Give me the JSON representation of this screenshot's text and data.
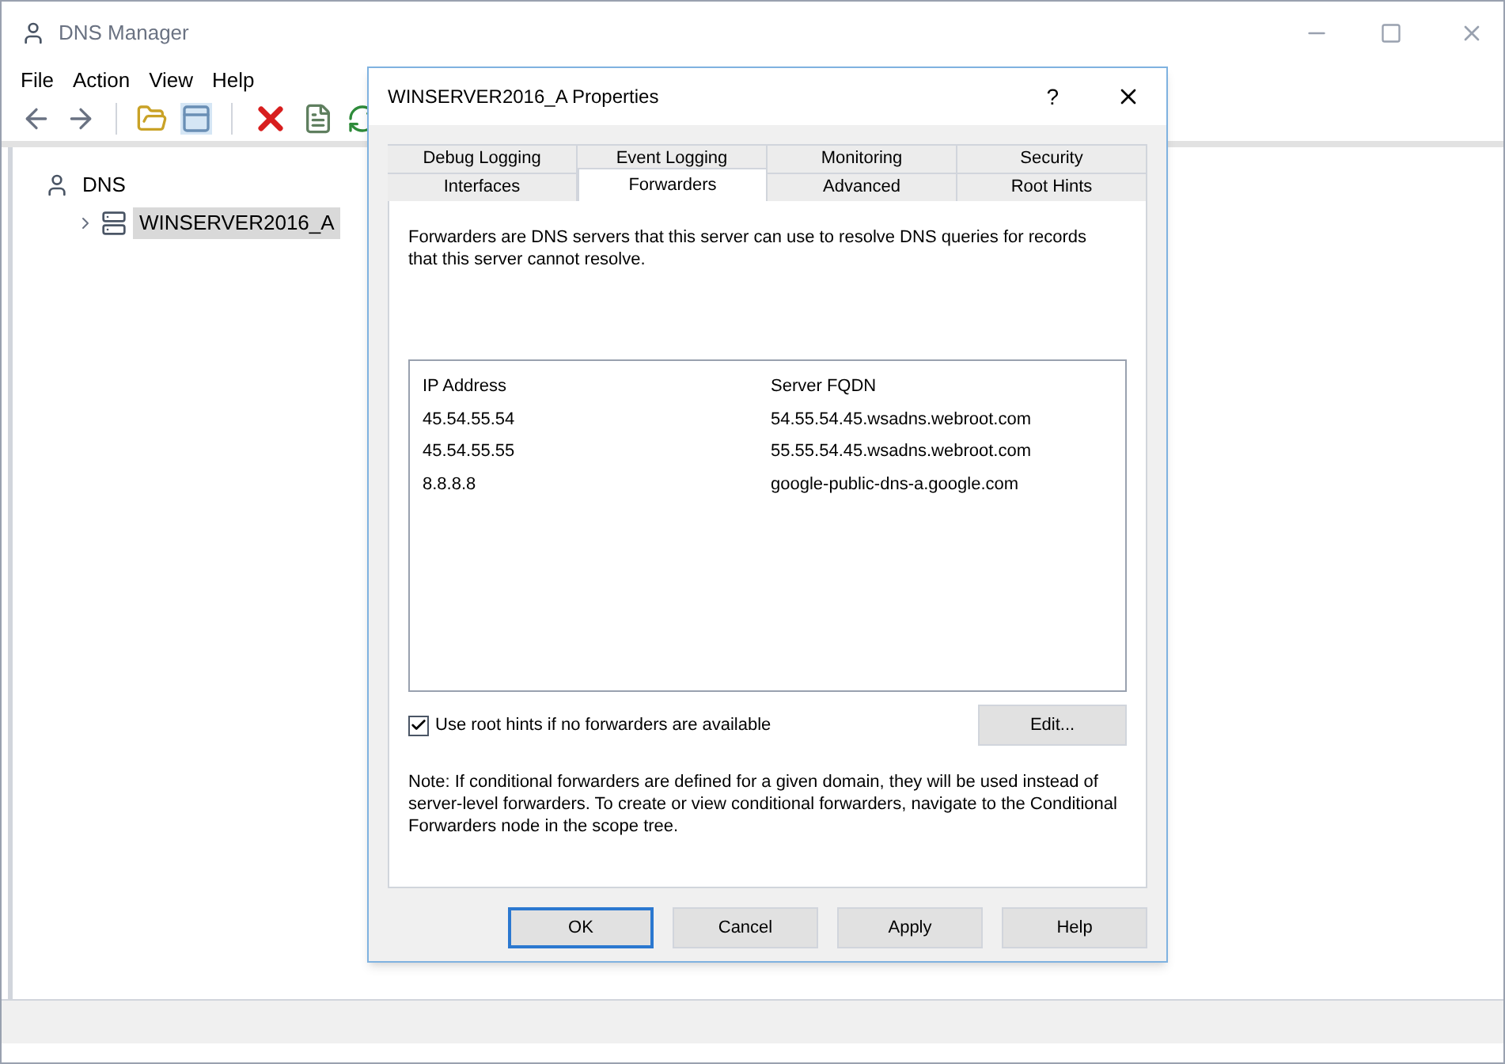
{
  "window": {
    "title": "DNS Manager"
  },
  "menu": [
    "File",
    "Action",
    "View",
    "Help"
  ],
  "toolbar": [
    {
      "kind": "back"
    },
    {
      "kind": "forward"
    },
    {
      "kind": "sep"
    },
    {
      "kind": "folder"
    },
    {
      "kind": "panel"
    },
    {
      "kind": "sep"
    },
    {
      "kind": "delete"
    },
    {
      "kind": "sheet"
    },
    {
      "kind": "refresh"
    }
  ],
  "tree": [
    {
      "label": "DNS",
      "kind": "root",
      "selected": false,
      "children": [
        {
          "label": "WINSERVER2016_A",
          "kind": "server",
          "selected": true,
          "expanded": false
        }
      ]
    }
  ],
  "dialog": {
    "title": "WINSERVER2016_A Properties",
    "help": "?",
    "tab_rows": [
      [
        {
          "label": "Debug Logging",
          "selected": false
        },
        {
          "label": "Event Logging",
          "selected": false
        },
        {
          "label": "Monitoring",
          "selected": false
        },
        {
          "label": "Security",
          "selected": false
        }
      ],
      [
        {
          "label": "Interfaces",
          "selected": false
        },
        {
          "label": "Forwarders",
          "selected": true
        },
        {
          "label": "Advanced",
          "selected": false
        },
        {
          "label": "Root Hints",
          "selected": false
        }
      ]
    ],
    "description": "Forwarders are DNS servers that this server can use to resolve DNS queries for records that this server cannot resolve.",
    "columns": [
      "IP Address",
      "Server FQDN"
    ],
    "rows": [
      [
        "45.54.55.54",
        "54.55.54.45.wsadns.webroot.com"
      ],
      [
        "45.54.55.55",
        "55.55.54.45.wsadns.webroot.com"
      ],
      [
        "8.8.8.8",
        "google-public-dns-a.google.com"
      ]
    ],
    "root_hints": {
      "label": "Use root hints if no forwarders are available",
      "checked": true
    },
    "edit_button": "Edit...",
    "note": "Note: If conditional forwarders are defined for a given domain, they will be used instead of server-level forwarders.  To create or view conditional forwarders, navigate to the Conditional Forwarders node in the scope tree.",
    "buttons": [
      {
        "label": "OK",
        "default": true
      },
      {
        "label": "Cancel",
        "default": false
      },
      {
        "label": "Apply",
        "default": false
      },
      {
        "label": "Help",
        "default": false
      }
    ]
  }
}
